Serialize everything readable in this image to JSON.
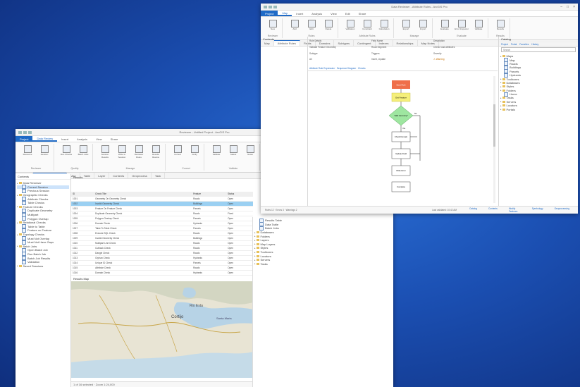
{
  "colors": {
    "accent": "#1f6ac6",
    "selected_row": "#9bd0f2",
    "flow_start": "#ef6f4a",
    "flow_step": "#f5ef7a",
    "flow_decision": "#9ee6a0"
  },
  "back_window": {
    "title": "Reviewer - Untitled Project - ArcGIS Pro",
    "tabs": [
      "Project",
      "Data Review",
      "Insert",
      "Analysis",
      "View",
      "Share"
    ],
    "ribbon": {
      "groups": [
        {
          "label": "Reviewer",
          "buttons": [
            "Resource",
            "Session"
          ]
        },
        {
          "label": "Quality",
          "buttons": [
            "Run Checks",
            "Batch Jobs"
          ]
        },
        {
          "label": "Manage",
          "buttons": [
            "Session Results",
            "Write to Session",
            "Reviewer Rules",
            "Results Review"
          ]
        },
        {
          "label": "Correct",
          "buttons": [
            "Correct",
            "Verify"
          ]
        },
        {
          "label": "Validate",
          "buttons": [
            "Validate",
            "Status",
            "Notes"
          ]
        },
        {
          "label": "Options",
          "buttons": [
            "Options"
          ]
        }
      ]
    },
    "doc_tabs": [
      "Catalog",
      "Data Review Results",
      "Map",
      "Table",
      "Layer",
      "Contents",
      "Geoprocess",
      "Task"
    ],
    "left_pane": {
      "title": "Contents",
      "items": [
        {
          "label": "Data Reviewer",
          "type": "folder"
        },
        {
          "label": "Current Session",
          "type": "item",
          "selected": true
        },
        {
          "label": "Previous Session",
          "type": "item"
        },
        {
          "label": "Geographic Checks",
          "type": "folder"
        },
        {
          "label": "Attribute Checks",
          "type": "item"
        },
        {
          "label": "Table Checks",
          "type": "item"
        },
        {
          "label": "Feature Checks",
          "type": "folder"
        },
        {
          "label": "Duplicate Geometry",
          "type": "item"
        },
        {
          "label": "Multipart",
          "type": "item"
        },
        {
          "label": "Polygon Overlap",
          "type": "item"
        },
        {
          "label": "Relational Checks",
          "type": "folder"
        },
        {
          "label": "Table to Table",
          "type": "item"
        },
        {
          "label": "Feature on Feature",
          "type": "item"
        },
        {
          "label": "Topology Checks",
          "type": "folder"
        },
        {
          "label": "Must Not Overlap",
          "type": "item"
        },
        {
          "label": "Must Not Have Gaps",
          "type": "item"
        },
        {
          "label": "Batch Jobs",
          "type": "folder"
        },
        {
          "label": "Open Batch Job",
          "type": "item"
        },
        {
          "label": "Run Batch Job",
          "type": "item"
        },
        {
          "label": "Batch Job Results",
          "type": "item"
        },
        {
          "label": "Validation",
          "type": "item"
        },
        {
          "label": "Saved Sessions",
          "type": "folder"
        }
      ]
    },
    "grid": {
      "caption": "Results",
      "search_placeholder": "Filter",
      "columns": [
        "ID",
        "Check Title",
        "Feature",
        "Status"
      ],
      "rows": [
        [
          "1001",
          "Geometry On Geometry Check",
          "Roads",
          "Open"
        ],
        [
          "1002",
          "Invalid Geometry Check",
          "Buildings",
          "Open"
        ],
        [
          "1003",
          "Feature On Feature Check",
          "Parcels",
          "Open"
        ],
        [
          "1004",
          "Duplicate Geometry Check",
          "Roads",
          "Fixed"
        ],
        [
          "1005",
          "Polygon Overlap Check",
          "Parcels",
          "Open"
        ],
        [
          "1006",
          "Domain Check",
          "Hydrants",
          "Open"
        ],
        [
          "1007",
          "Table To Table Check",
          "Parcels",
          "Open"
        ],
        [
          "1008",
          "Execute SQL Check",
          "Roads",
          "Open"
        ],
        [
          "1009",
          "Invalid Geometry Check",
          "Buildings",
          "Open"
        ],
        [
          "1010",
          "Multipart Line Check",
          "Roads",
          "Open"
        ],
        [
          "1011",
          "Cutback Check",
          "Roads",
          "Open"
        ],
        [
          "1012",
          "Dangle Check",
          "Roads",
          "Open"
        ],
        [
          "1013",
          "Orphan Check",
          "Hydrants",
          "Open"
        ],
        [
          "1014",
          "Unique ID Check",
          "Parcels",
          "Open"
        ],
        [
          "1015",
          "Attribute Check",
          "Roads",
          "Open"
        ],
        [
          "1016",
          "Domain Check",
          "Hydrants",
          "Open"
        ]
      ],
      "selected_row": 1
    },
    "map_caption": "Results Map",
    "map_labels": [
      "Rio Esta",
      "Cortijo",
      "Santa Maria"
    ],
    "status": "1 of 16 selected · Zoom 1:24,000",
    "right_pane_items": [
      "Results Table",
      "Data Table",
      "Batch Jobs",
      "Databases",
      "Folders",
      "Layers",
      "Map Layers",
      "Styles",
      "Toolboxes",
      "Locators",
      "Servers",
      "Tasks"
    ]
  },
  "front_window": {
    "title": "Data Reviewer - Attribute Rules - ArcGIS Pro",
    "tabs": [
      "Project",
      "Map",
      "Insert",
      "Analysis",
      "View",
      "Edit",
      "Share"
    ],
    "ribbon": {
      "groups": [
        {
          "label": "Reviewer",
          "buttons": [
            "New"
          ]
        },
        {
          "label": "Rules",
          "buttons": [
            "Add",
            "Edit",
            "Delete"
          ]
        },
        {
          "label": "Attribute Rules",
          "buttons": [
            "Validation",
            "Constraint",
            "Calculation"
          ]
        },
        {
          "label": "Manage",
          "buttons": [
            "Export",
            "Import"
          ]
        },
        {
          "label": "Evaluate",
          "buttons": [
            "Evaluate",
            "Error Inspector",
            "Validate"
          ]
        },
        {
          "label": "Results",
          "buttons": [
            "Results"
          ]
        }
      ]
    },
    "doc_tabs": [
      "Map",
      "Attribute Rules",
      "Fields",
      "Domains",
      "Subtypes",
      "Contingent",
      "Indexes",
      "Relationships",
      "Map Notes"
    ],
    "left_pane_title": "Contents",
    "props": {
      "name": "Rule Details",
      "field": "Field Name",
      "description": "Description",
      "subtype": "Subtype",
      "triggers": "Triggers",
      "severity": "Severity",
      "name_val": "Validate Feature Geometry",
      "field_val": "Road Segment",
      "desc_val": "Check road attributes",
      "subtype_val": "All",
      "triggers_val": "Insert, Update",
      "severity_val": "Warning"
    },
    "flow_header": "Attribute Rule Expression · Sequence Diagram · Checks",
    "flow_nodes": {
      "start": "Start Rule",
      "step1": "Get Feature",
      "decision": "Valid Geometry?",
      "step2": "Check Domain",
      "step3": "Update Field",
      "step4": "Write Error",
      "end": "Complete",
      "yes": "Yes",
      "no": "No"
    },
    "catalog": {
      "title": "Catalog",
      "tabs": [
        "Project",
        "Portal",
        "Favorites",
        "History"
      ],
      "search_placeholder": "Search",
      "items": [
        {
          "label": "Maps",
          "type": "folder"
        },
        {
          "label": "Map",
          "type": "layer"
        },
        {
          "label": "Roads",
          "type": "layer"
        },
        {
          "label": "Buildings",
          "type": "layer"
        },
        {
          "label": "Parcels",
          "type": "layer"
        },
        {
          "label": "Hydrants",
          "type": "layer"
        },
        {
          "label": "Toolboxes",
          "type": "folder"
        },
        {
          "label": "Databases",
          "type": "folder"
        },
        {
          "label": "Styles",
          "type": "folder"
        },
        {
          "label": "Folders",
          "type": "folder"
        },
        {
          "label": "Home",
          "type": "layer"
        },
        {
          "label": "Tasks",
          "type": "folder"
        },
        {
          "label": "Servers",
          "type": "folder"
        },
        {
          "label": "Locators",
          "type": "folder"
        },
        {
          "label": "Portals",
          "type": "folder"
        }
      ]
    },
    "status_items": [
      "Rules 12 · Errors 3 · Warnings 2",
      "Last validated: 10:42 AM"
    ],
    "bottom_tabs": [
      "Catalog",
      "Contents",
      "Modify Features",
      "Symbology",
      "Geoprocessing"
    ]
  }
}
